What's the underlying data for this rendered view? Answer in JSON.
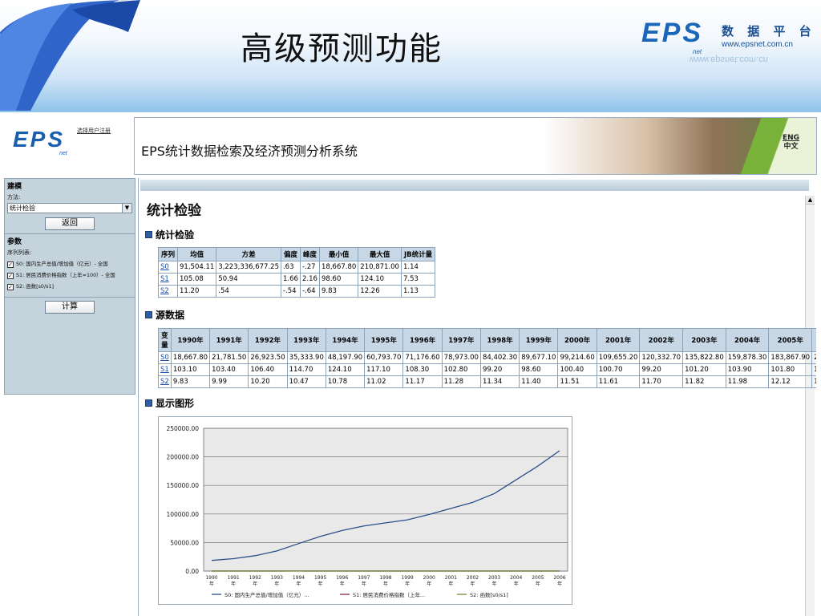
{
  "slide": {
    "title": "高级预测功能",
    "brand_logo": "EPS",
    "brand_logo_sub": "net",
    "brand_cn": "数 据 平 台",
    "brand_url": "www.epsnet.com.cn",
    "brand_url_reflection": "www.epsnet.com.cn"
  },
  "app": {
    "logo": "EPS",
    "logo_sub": "net",
    "logo_link": "选择用户注册",
    "banner_title": "EPS统计数据检索及经济预测分析系统",
    "lang_eng": "ENG",
    "lang_cn": "中文"
  },
  "sidebar": {
    "modeling_header": "建模",
    "method_label": "方法:",
    "method_value": "统计检验",
    "back_button": "返回",
    "params_header": "参数",
    "series_list_label": "序列列表:",
    "series": [
      {
        "label": "S0: 国内生产总值/增加值（亿元）- 全国",
        "checked": true
      },
      {
        "label": "S1: 居民消费价格指数（上年=100）- 全国",
        "checked": true
      },
      {
        "label": "S2: 函数[s0/s1]",
        "checked": true
      }
    ],
    "compute_button": "计算"
  },
  "main": {
    "page_title": "统计检验",
    "stats_section": "统计检验",
    "source_section": "源数据",
    "chart_section": "显示图形",
    "stats_table": {
      "headers": [
        "序列",
        "均值",
        "方差",
        "偏度",
        "峰度",
        "最小值",
        "最大值",
        "JB统计量"
      ],
      "rows": [
        [
          "S0",
          "91,504.11",
          "3,223,336,677.25",
          ".63",
          "-.27",
          "18,667.80",
          "210,871.00",
          "1.14"
        ],
        [
          "S1",
          "105.08",
          "50.94",
          "1.66",
          "2.16",
          "98.60",
          "124.10",
          "7.53"
        ],
        [
          "S2",
          "11.20",
          ".54",
          "-.54",
          "-.64",
          "9.83",
          "12.26",
          "1.13"
        ]
      ]
    },
    "source_table": {
      "headers": [
        "变量",
        "1990年",
        "1991年",
        "1992年",
        "1993年",
        "1994年",
        "1995年",
        "1996年",
        "1997年",
        "1998年",
        "1999年",
        "2000年",
        "2001年",
        "2002年",
        "2003年",
        "2004年",
        "2005年",
        "20"
      ],
      "rows": [
        [
          "S0",
          "18,667.80",
          "21,781.50",
          "26,923.50",
          "35,333.90",
          "48,197.90",
          "60,793.70",
          "71,176.60",
          "78,973.00",
          "84,402.30",
          "89,677.10",
          "99,214.60",
          "109,655.20",
          "120,332.70",
          "135,822.80",
          "159,878.30",
          "183,867.90",
          "210"
        ],
        [
          "S1",
          "103.10",
          "103.40",
          "106.40",
          "114.70",
          "124.10",
          "117.10",
          "108.30",
          "102.80",
          "99.20",
          "98.60",
          "100.40",
          "100.70",
          "99.20",
          "101.20",
          "103.90",
          "101.80",
          "101"
        ],
        [
          "S2",
          "9.83",
          "9.99",
          "10.20",
          "10.47",
          "10.78",
          "11.02",
          "11.17",
          "11.28",
          "11.34",
          "11.40",
          "11.51",
          "11.61",
          "11.70",
          "11.82",
          "11.98",
          "12.12",
          "12."
        ]
      ]
    }
  },
  "chart_data": {
    "type": "line",
    "x": [
      "1990年",
      "1991年",
      "1992年",
      "1993年",
      "1994年",
      "1995年",
      "1996年",
      "1997年",
      "1998年",
      "1999年",
      "2000年",
      "2001年",
      "2002年",
      "2003年",
      "2004年",
      "2005年",
      "2006年"
    ],
    "x_tick_top": [
      "1990",
      "1991",
      "1992",
      "1993",
      "1994",
      "1995",
      "1996",
      "1997",
      "1998",
      "1999",
      "2000",
      "2001",
      "2002",
      "2003",
      "2004",
      "2005",
      "2006"
    ],
    "x_tick_bottom": "年",
    "ylim": [
      0,
      250000
    ],
    "y_ticks": [
      "0.00",
      "50000.00",
      "100000.00",
      "150000.00",
      "200000.00",
      "250000.00"
    ],
    "grid": true,
    "legend_position": "bottom",
    "series": [
      {
        "name": "S0: 国内生产总值/增加值（亿元）...",
        "color": "#2a4f8a",
        "values": [
          18667.8,
          21781.5,
          26923.5,
          35333.9,
          48197.9,
          60793.7,
          71176.6,
          78973.0,
          84402.3,
          89677.1,
          99214.6,
          109655.2,
          120332.7,
          135822.8,
          159878.3,
          183867.9,
          210871.0
        ]
      },
      {
        "name": "S1: 居民消费价格指数（上年...",
        "color": "#8a2a5a",
        "values": [
          103.1,
          103.4,
          106.4,
          114.7,
          124.1,
          117.1,
          108.3,
          102.8,
          99.2,
          98.6,
          100.4,
          100.7,
          99.2,
          101.2,
          103.9,
          101.8,
          101.5
        ]
      },
      {
        "name": "S2: 函数[s0/s1]",
        "color": "#6f8f3a",
        "values": [
          9.83,
          9.99,
          10.2,
          10.47,
          10.78,
          11.02,
          11.17,
          11.28,
          11.34,
          11.4,
          11.51,
          11.61,
          11.7,
          11.82,
          11.98,
          12.12,
          12.26
        ]
      }
    ]
  }
}
